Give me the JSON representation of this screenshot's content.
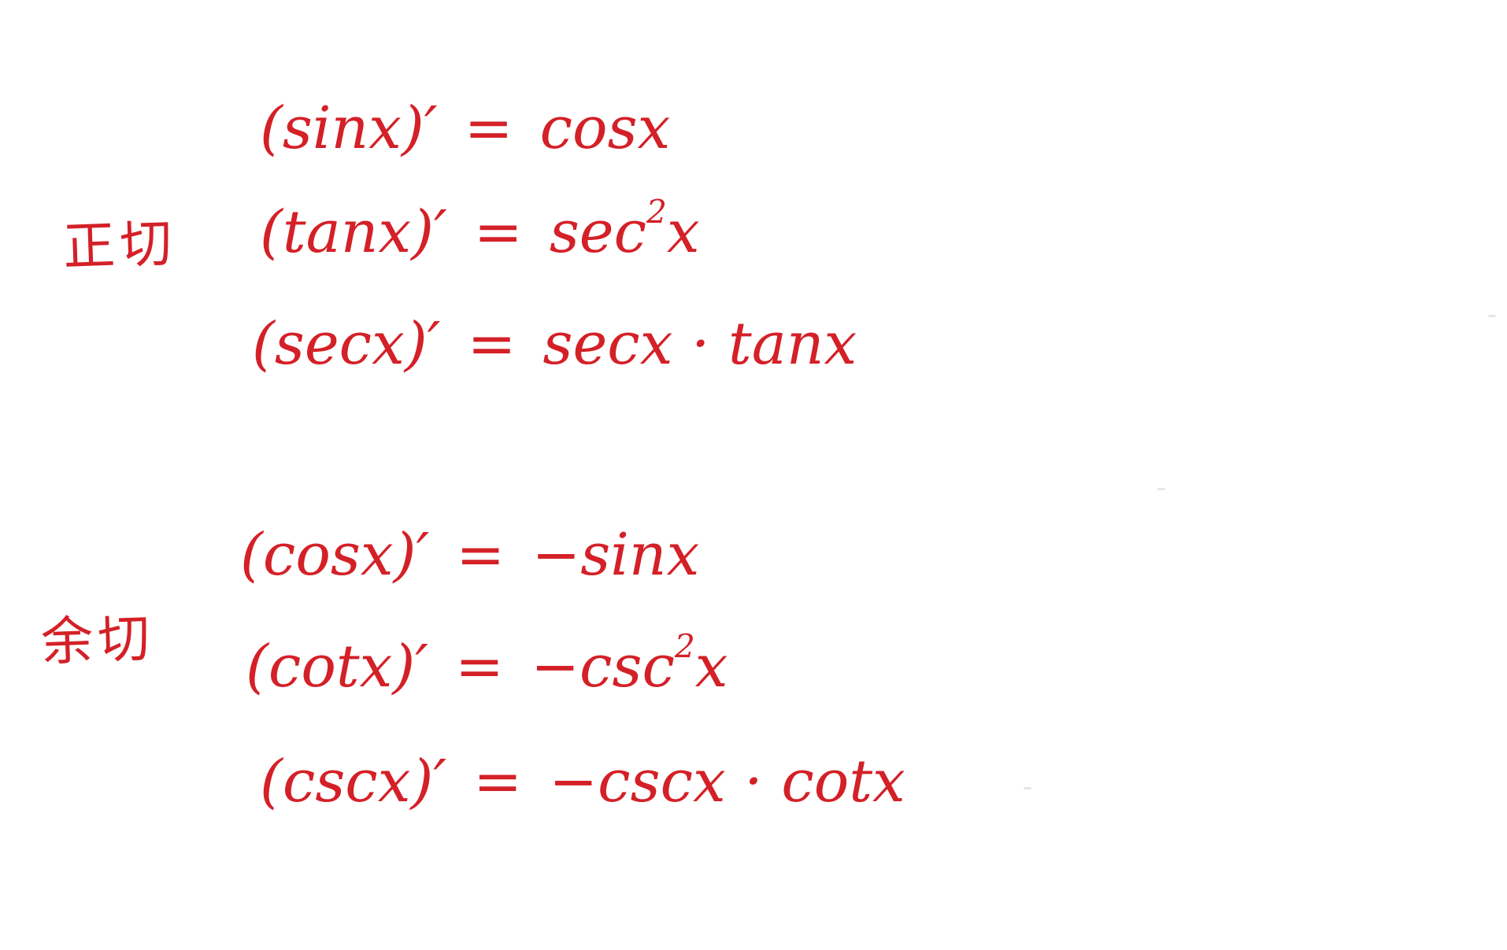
{
  "ink_color": "#d42027",
  "background_color": "#ffffff",
  "groups": [
    {
      "label": "正切",
      "formulas": [
        {
          "lhs": "(sinx)′",
          "eq": "=",
          "rhs": "cosx"
        },
        {
          "lhs": "(tanx)′",
          "eq": "=",
          "rhs_base": "sec",
          "rhs_exp": "2",
          "rhs_tail": "x"
        },
        {
          "lhs": "(secx)′",
          "eq": "=",
          "rhs": "secx · tanx"
        }
      ]
    },
    {
      "label": "余切",
      "formulas": [
        {
          "lhs": "(cosx)′",
          "eq": "=",
          "rhs": "−sinx"
        },
        {
          "lhs": "(cotx)′",
          "eq": "=",
          "rhs_base": "−csc",
          "rhs_exp": "2",
          "rhs_tail": "x"
        },
        {
          "lhs": "(cscx)′",
          "eq": "=",
          "rhs": "−cscx · cotx"
        }
      ]
    }
  ]
}
